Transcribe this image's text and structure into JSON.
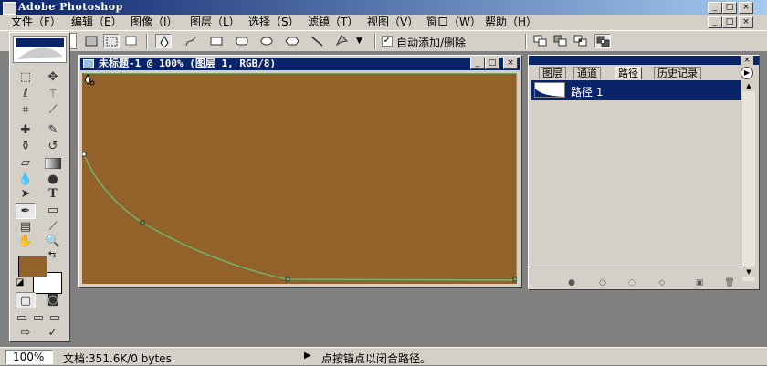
{
  "app": {
    "title": "Adobe Photoshop"
  },
  "menu": [
    "文件（F）",
    "编辑（E）",
    "图像（I）",
    "图层（L）",
    "选择（S）",
    "滤镜（T）",
    "视图（V）",
    "窗口（W）",
    "帮助（H）"
  ],
  "options_bar": {
    "auto_add_delete_label": "自动添加/删除",
    "auto_add_delete_checked": true
  },
  "tools": [
    "rect-marquee",
    "move",
    "lasso",
    "magic-wand",
    "crop",
    "slice",
    "healing-brush",
    "brush",
    "clone-stamp",
    "history-brush",
    "eraser",
    "gradient",
    "blur",
    "dodge",
    "path-select",
    "type",
    "pen",
    "rect-shape",
    "notes",
    "eyedropper",
    "hand",
    "zoom"
  ],
  "type_tool_glyph": "T",
  "colors": {
    "foreground": "#93612a",
    "background": "#ffffff",
    "canvas": "#93612a",
    "path_stroke": "#6fb56f",
    "title_bar": "#0a246a"
  },
  "document": {
    "title": "未标题-1 @ 100% (图层 1, RGB/8)"
  },
  "panel": {
    "tabs": [
      "图层",
      "通道",
      "路径",
      "历史记录"
    ],
    "active_tab": "路径",
    "paths": [
      {
        "name": "路径 1"
      }
    ]
  },
  "status": {
    "zoom": "100%",
    "doc_info": "文档:351.6K/0 bytes",
    "message": "点按锚点以闭合路径。"
  }
}
